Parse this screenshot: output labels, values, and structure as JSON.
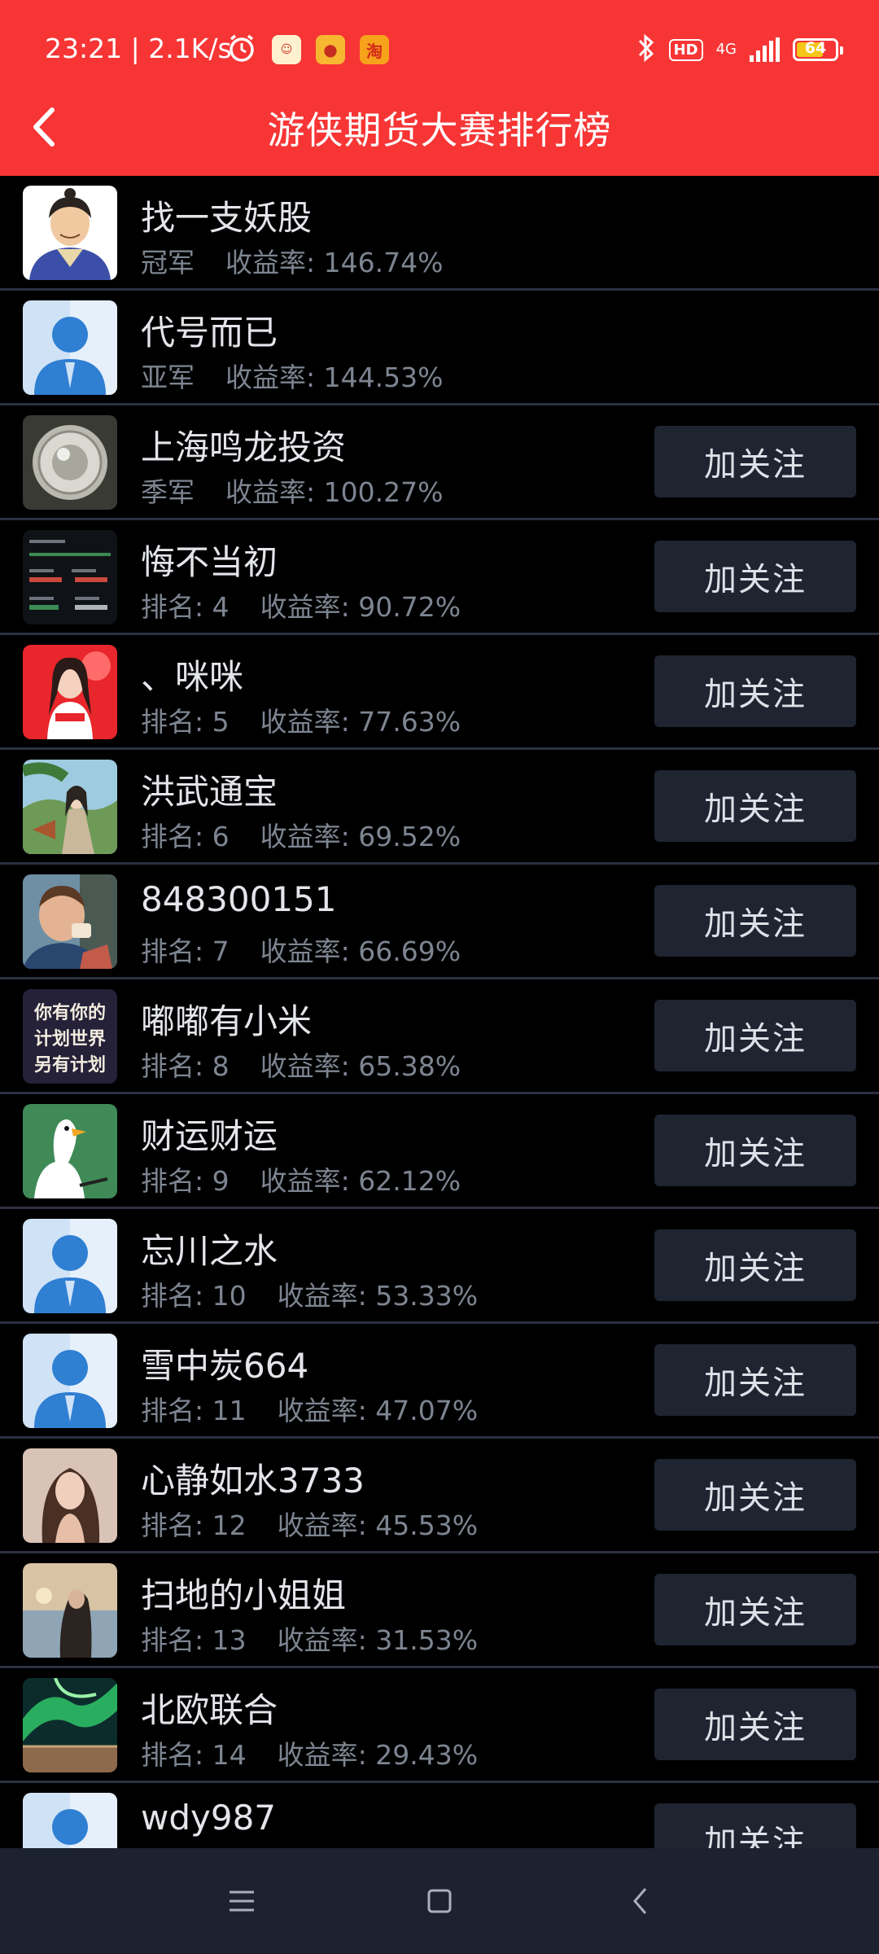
{
  "status_bar": {
    "time": "23:21 | 2.1K/s",
    "network": "4G",
    "hd_label": "HD",
    "battery_level": "64",
    "icons": [
      "alarm-icon",
      "app-icon-1",
      "app-icon-2",
      "taobao-icon",
      "bluetooth-icon",
      "signal-icon",
      "battery-icon"
    ]
  },
  "header": {
    "title": "游侠期货大赛排行榜",
    "back_icon": "back-arrow-icon"
  },
  "follow_label": "加关注",
  "rate_label": "收益率:",
  "rank_label": "排名:",
  "leaderboard": [
    {
      "name": "找一支妖股",
      "rank_text": "冠军",
      "rate": "146.74%",
      "avatar": "cartoon-man",
      "follow": false
    },
    {
      "name": "代号而已",
      "rank_text": "亚军",
      "rate": "144.53%",
      "avatar": "default-person",
      "follow": false
    },
    {
      "name": "上海鸣龙投资",
      "rank_text": "季军",
      "rate": "100.27%",
      "avatar": "watch-photo",
      "follow": true
    },
    {
      "name": "悔不当初",
      "rank_text": "4",
      "rate": "90.72%",
      "avatar": "screenshot-dark",
      "follow": true
    },
    {
      "name": "、咪咪",
      "rank_text": "5",
      "rate": "77.63%",
      "avatar": "girl-red",
      "follow": true
    },
    {
      "name": "洪武通宝",
      "rank_text": "6",
      "rate": "69.52%",
      "avatar": "painting",
      "follow": true
    },
    {
      "name": "848300151",
      "rank_text": "7",
      "rate": "66.69%",
      "avatar": "man-photo",
      "follow": true
    },
    {
      "name": "嘟嘟有小米",
      "rank_text": "8",
      "rate": "65.38%",
      "avatar": "text-poster",
      "follow": true
    },
    {
      "name": "财运财运",
      "rank_text": "9",
      "rate": "62.12%",
      "avatar": "goose-green",
      "follow": true
    },
    {
      "name": "忘川之水",
      "rank_text": "10",
      "rate": "53.33%",
      "avatar": "default-person",
      "follow": true
    },
    {
      "name": "雪中炭664",
      "rank_text": "11",
      "rate": "47.07%",
      "avatar": "default-person",
      "follow": true
    },
    {
      "name": "心静如水3733",
      "rank_text": "12",
      "rate": "45.53%",
      "avatar": "woman-portrait",
      "follow": true
    },
    {
      "name": "扫地的小姐姐",
      "rank_text": "13",
      "rate": "31.53%",
      "avatar": "sunset-girl",
      "follow": true
    },
    {
      "name": "北欧联合",
      "rank_text": "14",
      "rate": "29.43%",
      "avatar": "aurora",
      "follow": true
    },
    {
      "name": "wdy987",
      "rank_text": "",
      "rate": "",
      "avatar": "default-person",
      "follow": true
    }
  ],
  "poster_text": "你有你的计划世界另有计划",
  "bottom_nav": [
    "menu-icon",
    "home-icon",
    "back-icon"
  ]
}
